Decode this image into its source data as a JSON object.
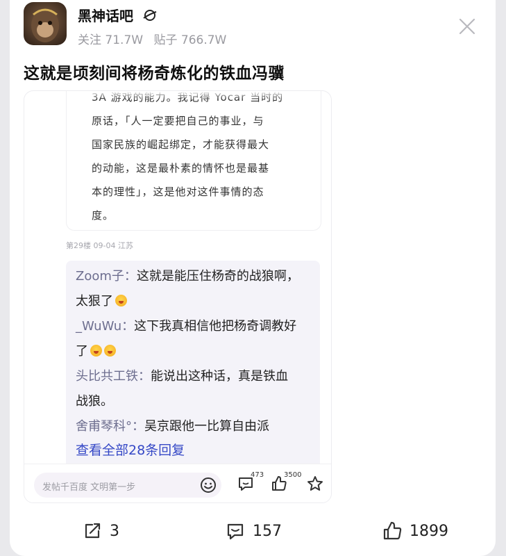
{
  "forum": {
    "name": "黑神话吧",
    "followers": "关注 71.7W",
    "posts": "贴子 766.7W"
  },
  "post": {
    "title": "这就是顷刻间将杨奇炼化的铁血冯骥"
  },
  "screenshot": {
    "quote_lines": [
      "3A 游戏的能力。我记得 Yocar 当时的",
      "原话，「人一定要把自己的事业，与",
      "国家民族的崛起绑定，才能获得最大",
      "的动能，这是最朴素的情怀也是最基",
      "本的理性」，这是他对这件事情的态",
      "度。"
    ],
    "floor_meta": "第29楼 09-04 江苏",
    "replies": [
      {
        "user": "Zoom子：",
        "text": "这就是能压住杨奇的战狼啊，",
        "cont": "太狠了"
      },
      {
        "user": "_WuWu：",
        "text": "这下我真相信他把杨奇调教好",
        "cont": "了"
      },
      {
        "user": "头比共工铁：",
        "text": "能说出这种话，真是铁血",
        "cont": "战狼。"
      },
      {
        "user": "舍甫琴科°：",
        "text": "吴京跟他一比算自由派"
      }
    ],
    "view_all": "查看全部28条回复",
    "input_placeholder": "发帖千百度 文明第一步",
    "comment_count": "473",
    "like_count": "3500"
  },
  "footer": {
    "share_count": "3",
    "comment_count": "157",
    "like_count": "1899"
  },
  "colors": {
    "link": "#3548c6",
    "username": "#6d6e8f",
    "reply_bg": "#f4f3f9"
  }
}
